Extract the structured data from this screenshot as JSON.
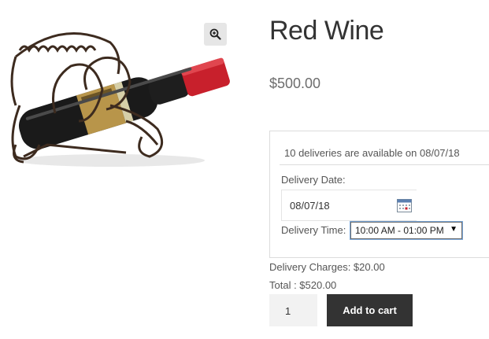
{
  "product": {
    "title": "Red Wine",
    "price": "$500.00",
    "image_alt": "wine-bottle-in-metal-holder"
  },
  "icons": {
    "zoom": "zoom-in-icon",
    "calendar": "calendar-icon",
    "dropdown": "chevron-down-icon"
  },
  "delivery": {
    "availability": "10 deliveries are available on 08/07/18",
    "date_label": "Delivery Date:",
    "date_value": "08/07/18",
    "time_label": "Delivery Time:",
    "time_value": "10:00 AM - 01:00 PM",
    "charges": "Delivery Charges: $20.00",
    "total": "Total : $520.00"
  },
  "cart": {
    "quantity": "1",
    "add_label": "Add to cart"
  },
  "colors": {
    "button_bg": "#333333",
    "bottle_cap": "#c8202c",
    "label_gold": "#b8954a"
  }
}
